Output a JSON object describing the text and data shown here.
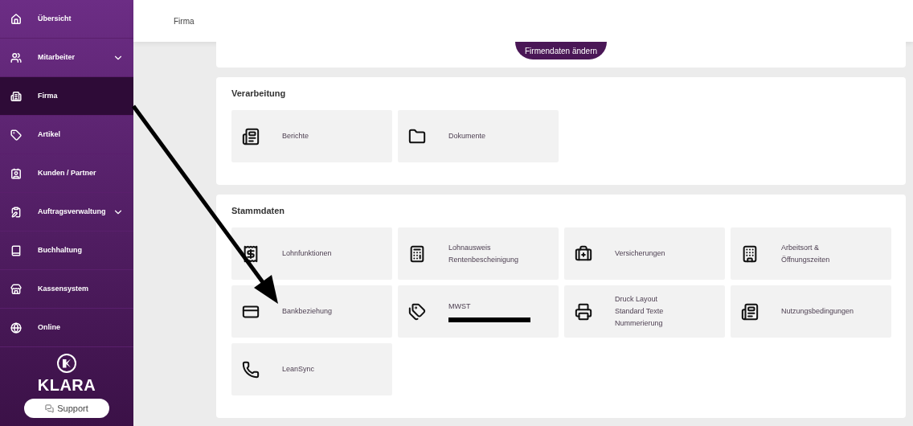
{
  "sidebar": {
    "items": [
      {
        "label": "Übersicht",
        "selected": false,
        "expandable": false
      },
      {
        "label": "Mitarbeiter",
        "selected": false,
        "expandable": true
      },
      {
        "label": "Firma",
        "selected": true,
        "expandable": false
      },
      {
        "label": "Artikel",
        "selected": false,
        "expandable": false
      },
      {
        "label": "Kunden / Partner",
        "selected": false,
        "expandable": false
      },
      {
        "label": "Auftragsverwaltung",
        "selected": false,
        "expandable": true
      },
      {
        "label": "Buchhaltung",
        "selected": false,
        "expandable": false
      },
      {
        "label": "Kassensystem",
        "selected": false,
        "expandable": false
      },
      {
        "label": "Online",
        "selected": false,
        "expandable": false
      }
    ],
    "logo": "KLARA",
    "support_button": "Support"
  },
  "header": {
    "title": "Firma"
  },
  "company_card": {
    "button": "Firmendaten ändern"
  },
  "sections": [
    {
      "title": "Verarbeitung",
      "tiles": [
        {
          "lines": [
            "Berichte"
          ],
          "redacted": false
        },
        {
          "lines": [
            "Dokumente"
          ],
          "redacted": false
        }
      ]
    },
    {
      "title": "Stammdaten",
      "tiles": [
        {
          "lines": [
            "Lohnfunktionen"
          ],
          "redacted": false
        },
        {
          "lines": [
            "Lohnausweis",
            "Rentenbescheinigung"
          ],
          "redacted": false
        },
        {
          "lines": [
            "Versicherungen"
          ],
          "redacted": false
        },
        {
          "lines": [
            "Arbeitsort &",
            "Öffnungszeiten"
          ],
          "redacted": false
        },
        {
          "lines": [
            "Bankbeziehung"
          ],
          "redacted": false
        },
        {
          "lines": [
            "MWST"
          ],
          "redacted": true
        },
        {
          "lines": [
            "Druck Layout",
            "Standard Texte",
            "Nummerierung"
          ],
          "redacted": false
        },
        {
          "lines": [
            "Nutzungsbedingungen"
          ],
          "redacted": false
        },
        {
          "lines": [
            "LeanSync"
          ],
          "redacted": false
        }
      ]
    }
  ],
  "annotations": [
    {
      "kind": "arrow"
    }
  ]
}
